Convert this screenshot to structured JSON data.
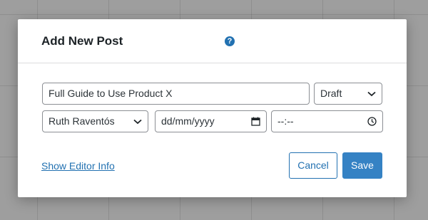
{
  "modal": {
    "title": "Add New Post",
    "help_icon": "question-circle-icon",
    "help_glyph": "?"
  },
  "form": {
    "title_value": "Full Guide to Use Product X",
    "status_value": "Draft",
    "author_value": "Ruth Raventós",
    "date_placeholder": "dd/mm/yyyy",
    "time_placeholder": "--:--"
  },
  "footer": {
    "editor_link": "Show Editor Info",
    "cancel_label": "Cancel",
    "save_label": "Save"
  },
  "colors": {
    "accent": "#2271b1",
    "save_bg": "#3582c4",
    "backdrop": "#9e9e9e"
  }
}
